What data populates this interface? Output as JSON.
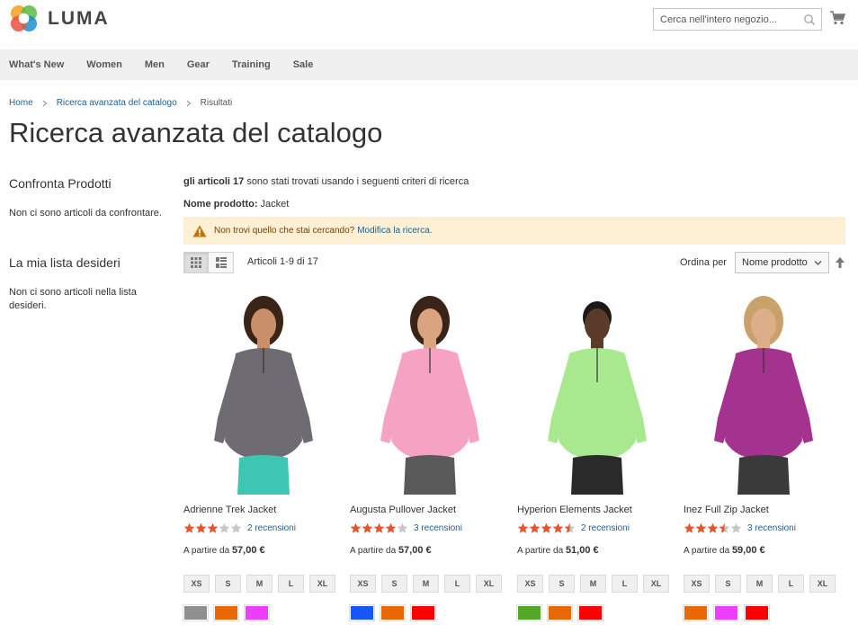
{
  "header": {
    "logo_text": "LUMA",
    "search_placeholder": "Cerca nell'intero negozio..."
  },
  "nav": {
    "items": [
      {
        "label": "What's New"
      },
      {
        "label": "Women"
      },
      {
        "label": "Men"
      },
      {
        "label": "Gear"
      },
      {
        "label": "Training"
      },
      {
        "label": "Sale"
      }
    ]
  },
  "breadcrumb": {
    "home": "Home",
    "advanced": "Ricerca avanzata del catalogo",
    "current": "Risultati"
  },
  "page_title": "Ricerca avanzata del catalogo",
  "sidebar": {
    "compare_title": "Confronta Prodotti",
    "compare_empty": "Non ci sono articoli da confrontare.",
    "wishlist_title": "La mia lista desideri",
    "wishlist_empty": "Non ci sono articoli nella lista desideri."
  },
  "results": {
    "count_bold": "gli articoli 17",
    "count_rest": "sono stati trovati usando i seguenti criteri di ricerca",
    "criteria_label": "Nome prodotto:",
    "criteria_value": "Jacket",
    "notice_text": "Non trovi quello che stai cercando?",
    "notice_link": "Modifica la ricerca."
  },
  "toolbar": {
    "count": "Articoli 1-9 di 17",
    "sort_label": "Ordina per",
    "sort_value": "Nome prodotto"
  },
  "products": [
    {
      "name": "Adrienne Trek Jacket",
      "rating": 3,
      "reviews": "2 recensioni",
      "price_prefix": "A partire da",
      "price": "57,00 €",
      "sizes": [
        "XS",
        "S",
        "M",
        "L",
        "XL"
      ],
      "colors": [
        "#8f8f8f",
        "#eb6703",
        "#ef3dff"
      ],
      "garment_color": "#6e6c72",
      "pants_color": "#3fc6b3",
      "skin": "#c98f6b"
    },
    {
      "name": "Augusta Pullover Jacket",
      "rating": 4,
      "reviews": "3 recensioni",
      "price_prefix": "A partire da",
      "price": "57,00 €",
      "sizes": [
        "XS",
        "S",
        "M",
        "L",
        "XL"
      ],
      "colors": [
        "#1857f7",
        "#eb6703",
        "#ff0000"
      ],
      "garment_color": "#f6a2c3",
      "pants_color": "#5a5a5a",
      "skin": "#d9a47f"
    },
    {
      "name": "Hyperion Elements Jacket",
      "rating": 4.5,
      "reviews": "2 recensioni",
      "price_prefix": "A partire da",
      "price": "51,00 €",
      "sizes": [
        "XS",
        "S",
        "M",
        "L",
        "XL"
      ],
      "colors": [
        "#53a828",
        "#eb6703",
        "#ff0000"
      ],
      "garment_color": "#a8e88f",
      "pants_color": "#2a2a2a",
      "skin": "#5a3a28"
    },
    {
      "name": "Inez Full Zip Jacket",
      "rating": 3.5,
      "reviews": "3 recensioni",
      "price_prefix": "A partire da",
      "price": "59,00 €",
      "sizes": [
        "XS",
        "S",
        "M",
        "L",
        "XL"
      ],
      "colors": [
        "#eb6703",
        "#ef3dff",
        "#ff0000"
      ],
      "garment_color": "#a3338f",
      "pants_color": "#3a3a3a",
      "skin": "#dcae8a"
    }
  ]
}
